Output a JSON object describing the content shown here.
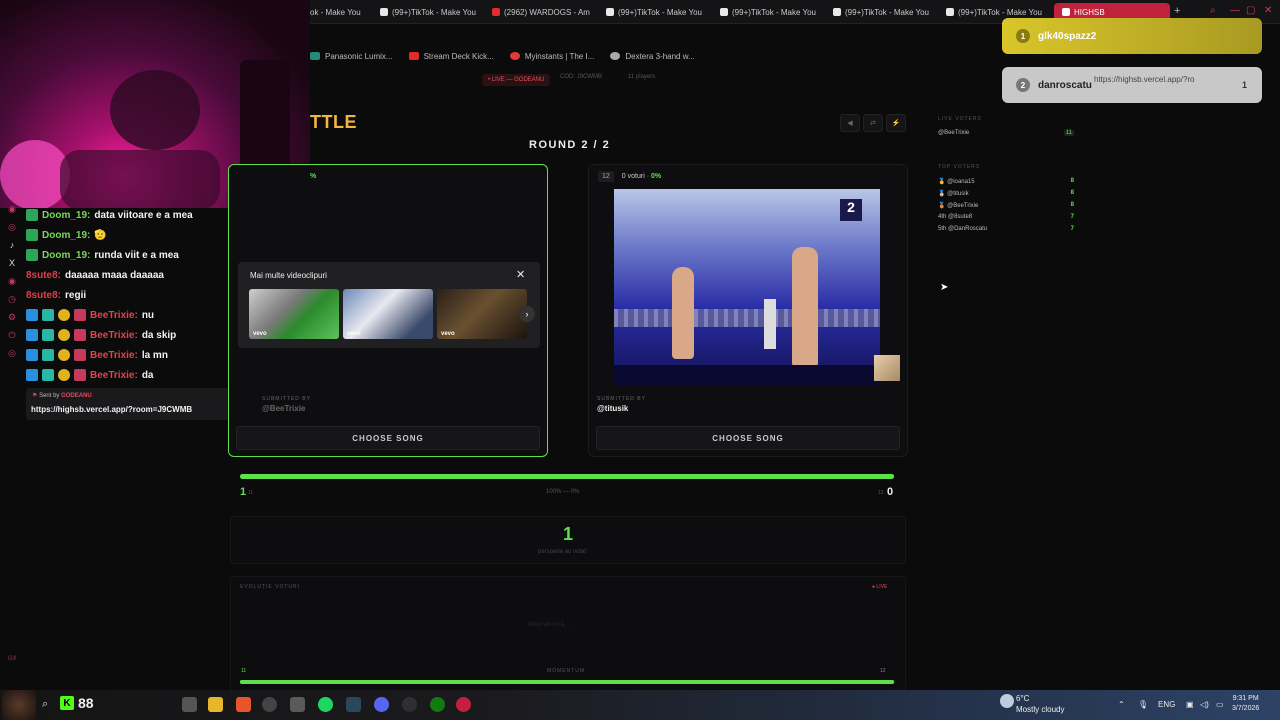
{
  "browser": {
    "tabs": [
      {
        "label": "ok - Make You",
        "yt": false
      },
      {
        "label": "(99+)TikTok - Make You",
        "yt": false
      },
      {
        "label": "(2962) WARDOGS - Am",
        "yt": true
      },
      {
        "label": "(99+)TikTok - Make You",
        "yt": false
      },
      {
        "label": "(99+)TikTok - Make You",
        "yt": false
      },
      {
        "label": "(99+)TikTok - Make You",
        "yt": false
      },
      {
        "label": "(99+)TikTok - Make You",
        "yt": false
      }
    ],
    "active_tab": "HIGHSB",
    "bookmarks": [
      {
        "label": "Panasonic Lumix...",
        "color": "#2a8a7a"
      },
      {
        "label": "Stream Deck Kick...",
        "color": "#e32b2b"
      },
      {
        "label": "Myinstants | The I...",
        "color": "#e33a3a"
      },
      {
        "label": "Dextera 3-hand w...",
        "color": "#aaaaaa"
      }
    ]
  },
  "chat": {
    "messages": [
      {
        "badges": [
          "green"
        ],
        "user": "Doom_19:",
        "user_color": "green",
        "text": "data viitoare e a mea"
      },
      {
        "badges": [
          "green"
        ],
        "user": "Doom_19:",
        "user_color": "green",
        "text": "🫡"
      },
      {
        "badges": [
          "green"
        ],
        "user": "Doom_19:",
        "user_color": "green",
        "text": "runda viit e a mea"
      },
      {
        "badges": [],
        "user": "8sute8:",
        "user_color": "pink",
        "text": "daaaaa maaa daaaaa"
      },
      {
        "badges": [],
        "user": "8sute8:",
        "user_color": "pink",
        "text": "regii"
      },
      {
        "badges": [
          "blue",
          "teal",
          "gold",
          "pink"
        ],
        "user": "BeeTrixie:",
        "user_color": "red",
        "text": "nu"
      },
      {
        "badges": [
          "blue",
          "teal",
          "gold",
          "pink"
        ],
        "user": "BeeTrixie:",
        "user_color": "red",
        "text": "da skip"
      },
      {
        "badges": [
          "blue",
          "teal",
          "gold",
          "pink"
        ],
        "user": "BeeTrixie:",
        "user_color": "red",
        "text": "la mn"
      },
      {
        "badges": [
          "blue",
          "teal",
          "gold",
          "pink"
        ],
        "user": "BeeTrixie:",
        "user_color": "red",
        "text": "da"
      }
    ],
    "sent_by_label": "Sent by",
    "sent_by_user": "GODEANU",
    "sent_url": "https://highsb.vercel.app/?room=J9CWMB"
  },
  "app": {
    "live_pill": "• LIVE — GODEANU",
    "code_pill": "COD: J9CWMB",
    "players_pill": "11 players",
    "title_fragment": "TTLE",
    "round": "ROUND 2 / 2",
    "left_pct": "%",
    "right_card": {
      "num": "12",
      "votes": "0 voturi · ",
      "pct": "0%"
    },
    "yt_overlay": {
      "title": "Mai multe videoclipuri",
      "close": "✕",
      "vevo": "vevo",
      "next": "›"
    },
    "submitted_label": "SUBMITTED BY",
    "left_submitter": "@BeeTrixie",
    "right_submitter": "@titusik",
    "choose_label": "CHOOSE SONG",
    "score_left": "1",
    "score_right": "0",
    "score_left_tag": "11",
    "score_right_tag": "12",
    "score_mid": "100% — 0%",
    "votes_count": "1",
    "votes_label": "persoane au votat",
    "evo_title": "EVOLUȚIE VOTURI",
    "evo_live": "● LIVE",
    "evo_empty": "Nicio vot încă...",
    "momentum_label": "MOMENTUM",
    "momentum_left": "11",
    "momentum_right": "12",
    "vote_share_left": 1.0,
    "momentum_share_left": 1.0,
    "controls": [
      "◀",
      "⇄",
      "⚡"
    ]
  },
  "right_panel": {
    "live_voters_title": "LIVE VOTERS",
    "live_voters": [
      {
        "name": "@BeeTrixie",
        "tag": "11"
      }
    ],
    "top_voters_title": "TOP VOTERS",
    "top_voters": [
      {
        "name": "🥇 @ioana15",
        "value": "8"
      },
      {
        "name": "🥈 @titusik",
        "value": "8"
      },
      {
        "name": "🥉 @BeeTrixie",
        "value": "8"
      },
      {
        "name": "4th @8sute8",
        "value": "7"
      },
      {
        "name": "5th @DanRoscatu",
        "value": "7"
      }
    ]
  },
  "notifications": [
    {
      "rank": "1",
      "name": "glk40spazz2"
    },
    {
      "rank": "2",
      "name": "danroscatu",
      "url": "https://highsb.vercel.app/?ro",
      "count": "1"
    }
  ],
  "taskbar": {
    "kick_count": "88",
    "weather_temp": "6°C",
    "weather_desc": "Mostly cloudy",
    "lang": "ENG",
    "time": "9:31 PM",
    "date": "3/7/2026"
  }
}
